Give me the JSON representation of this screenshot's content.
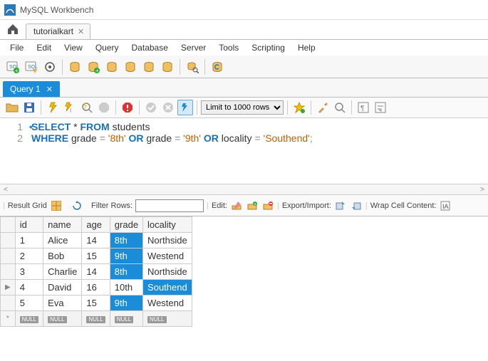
{
  "app": {
    "title": "MySQL Workbench"
  },
  "connection_tab": {
    "label": "tutorialkart"
  },
  "menu": {
    "items": [
      "File",
      "Edit",
      "View",
      "Query",
      "Database",
      "Server",
      "Tools",
      "Scripting",
      "Help"
    ]
  },
  "query_tab": {
    "label": "Query 1"
  },
  "editor": {
    "limit_label": "Limit to 1000 rows",
    "lines": [
      {
        "num": "1",
        "marker": true
      },
      {
        "num": "2",
        "marker": false
      }
    ],
    "sql": {
      "kw_select": "SELECT",
      "star": " * ",
      "kw_from": "FROM",
      "tbl": " students",
      "kw_where": "WHERE",
      "col_grade": " grade ",
      "eq": "=",
      "val_8th": "'8th'",
      "kw_or": "OR",
      "val_9th": "'9th'",
      "col_locality": " locality ",
      "val_southend": "'Southend'",
      "semicolon": ";"
    }
  },
  "result_toolbar": {
    "result_grid": "Result Grid",
    "filter_label": "Filter Rows:",
    "filter_value": "",
    "edit_label": "Edit:",
    "export_label": "Export/Import:",
    "wrap_label": "Wrap Cell Content:"
  },
  "grid": {
    "columns": [
      "id",
      "name",
      "age",
      "grade",
      "locality"
    ],
    "rows": [
      {
        "cursor": "",
        "id": "1",
        "name": "Alice",
        "age": "14",
        "grade": "8th",
        "grade_hl": true,
        "locality": "Northside",
        "locality_hl": false
      },
      {
        "cursor": "",
        "id": "2",
        "name": "Bob",
        "age": "15",
        "grade": "9th",
        "grade_hl": true,
        "locality": "Westend",
        "locality_hl": false
      },
      {
        "cursor": "",
        "id": "3",
        "name": "Charlie",
        "age": "14",
        "grade": "8th",
        "grade_hl": true,
        "locality": "Northside",
        "locality_hl": false
      },
      {
        "cursor": "▶",
        "id": "4",
        "name": "David",
        "age": "16",
        "grade": "10th",
        "grade_hl": false,
        "locality": "Southend",
        "locality_hl": true
      },
      {
        "cursor": "",
        "id": "5",
        "name": "Eva",
        "age": "15",
        "grade": "9th",
        "grade_hl": true,
        "locality": "Westend",
        "locality_hl": false
      }
    ],
    "null_label": "NULL"
  }
}
